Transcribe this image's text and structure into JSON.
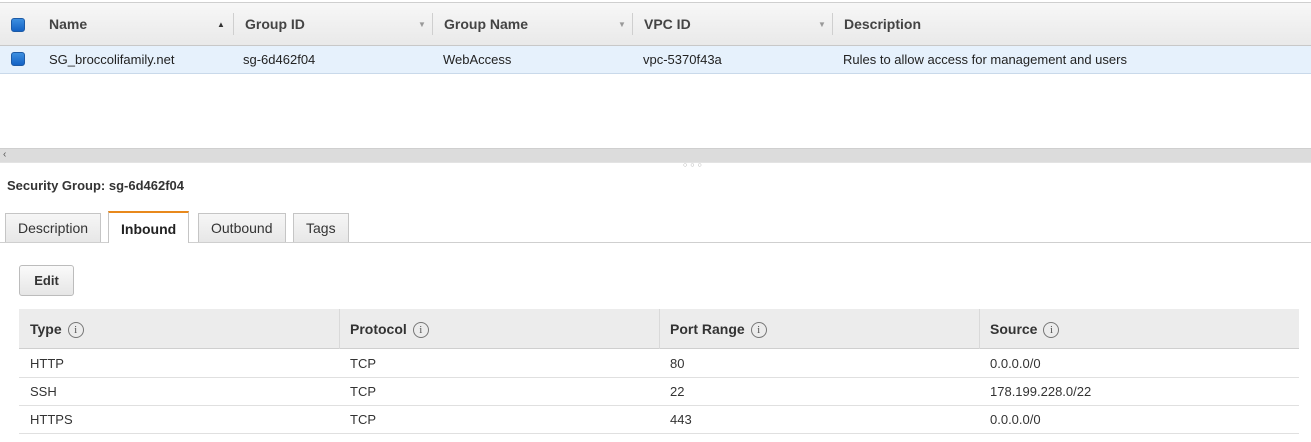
{
  "grid": {
    "columns": [
      {
        "label": "Name"
      },
      {
        "label": "Group ID"
      },
      {
        "label": "Group Name"
      },
      {
        "label": "VPC ID"
      },
      {
        "label": "Description"
      }
    ],
    "rows": [
      {
        "name": "SG_broccolifamily.net",
        "group_id": "sg-6d462f04",
        "group_name": "WebAccess",
        "vpc_id": "vpc-5370f43a",
        "description": "Rules to allow access for management and users"
      }
    ]
  },
  "detail": {
    "title": "Security Group: sg-6d462f04",
    "tabs": [
      {
        "label": "Description"
      },
      {
        "label": "Inbound",
        "active": true
      },
      {
        "label": "Outbound"
      },
      {
        "label": "Tags"
      }
    ],
    "edit_label": "Edit"
  },
  "rules": {
    "columns": [
      {
        "label": "Type"
      },
      {
        "label": "Protocol"
      },
      {
        "label": "Port Range"
      },
      {
        "label": "Source"
      }
    ],
    "rows": [
      {
        "type": "HTTP",
        "protocol": "TCP",
        "port_range": "80",
        "source": "0.0.0.0/0"
      },
      {
        "type": "SSH",
        "protocol": "TCP",
        "port_range": "22",
        "source": "178.199.228.0/22"
      },
      {
        "type": "HTTPS",
        "protocol": "TCP",
        "port_range": "443",
        "source": "0.0.0.0/0"
      }
    ]
  },
  "icons": {
    "sort": "sort-ascending-icon",
    "column_menu": "chevron-down-icon",
    "info": "info-icon",
    "scroll_left": "scroll-left-icon",
    "splitter": "drag-handle-icon"
  },
  "colors": {
    "selected_row": "#e6f1fc",
    "checkbox": "#1462c4",
    "active_tab_accent": "#e8891c"
  }
}
